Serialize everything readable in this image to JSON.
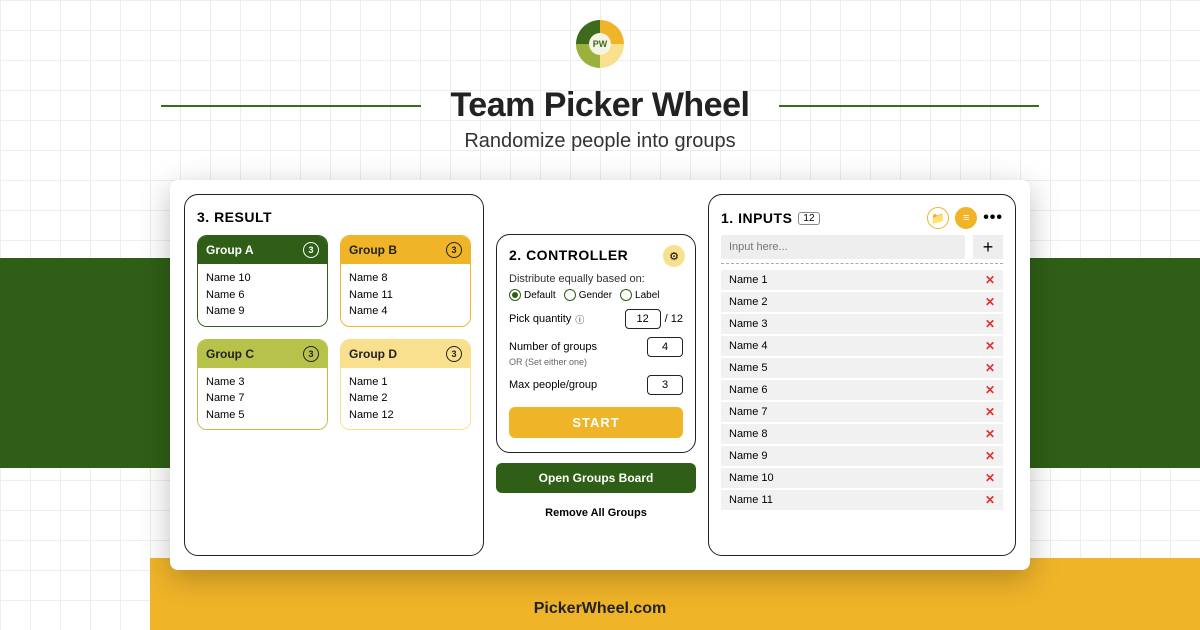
{
  "app_title": "Team Picker Wheel",
  "subtitle": "Randomize people into groups",
  "footer": "PickerWheel.com",
  "result": {
    "title": "3. RESULT",
    "groups": [
      {
        "name": "Group A",
        "count": "3",
        "cls": "g-a",
        "members": [
          "Name 10",
          "Name 6",
          "Name 9"
        ]
      },
      {
        "name": "Group B",
        "count": "3",
        "cls": "g-b",
        "members": [
          "Name 8",
          "Name 11",
          "Name 4"
        ]
      },
      {
        "name": "Group C",
        "count": "3",
        "cls": "g-c",
        "members": [
          "Name 3",
          "Name 7",
          "Name 5"
        ]
      },
      {
        "name": "Group D",
        "count": "3",
        "cls": "g-d",
        "members": [
          "Name 1",
          "Name 2",
          "Name 12"
        ]
      }
    ]
  },
  "controller": {
    "title": "2. CONTROLLER",
    "distribute_label": "Distribute equally based on:",
    "options": [
      {
        "label": "Default",
        "selected": true
      },
      {
        "label": "Gender",
        "selected": false
      },
      {
        "label": "Label",
        "selected": false
      }
    ],
    "pick_qty_label": "Pick quantity",
    "pick_qty_value": "12",
    "pick_qty_total": "/ 12",
    "num_groups_label": "Number of groups",
    "num_groups_value": "4",
    "or_note": "OR (Set either one)",
    "max_people_label": "Max people/group",
    "max_people_value": "3",
    "start": "START",
    "open_board": "Open Groups Board",
    "remove_all": "Remove All Groups"
  },
  "inputs": {
    "title": "1. INPUTS",
    "count": "12",
    "placeholder": "Input here...",
    "list": [
      "Name 1",
      "Name 2",
      "Name 3",
      "Name 4",
      "Name 5",
      "Name 6",
      "Name 7",
      "Name 8",
      "Name 9",
      "Name 10",
      "Name 11"
    ]
  }
}
